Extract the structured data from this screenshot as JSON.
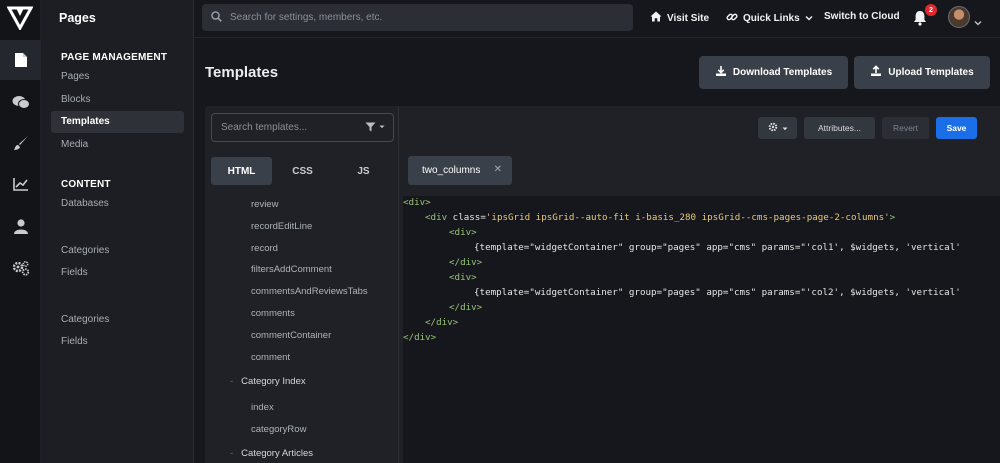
{
  "app": {
    "title": "Pages"
  },
  "sidebar": {
    "sections": [
      {
        "title": "PAGE MANAGEMENT",
        "items": [
          "Pages",
          "Blocks",
          "Templates",
          "Media"
        ]
      },
      {
        "title": "CONTENT",
        "items": [
          "Databases"
        ]
      }
    ],
    "extra_groups": [
      [
        "Categories",
        "Fields"
      ],
      [
        "Categories",
        "Fields"
      ]
    ],
    "active_item": "Templates"
  },
  "topbar": {
    "search_placeholder": "Search for settings, members, etc.",
    "visit_site": "Visit Site",
    "quick_links": "Quick Links",
    "switch_cloud": "Switch to Cloud",
    "notification_count": "2"
  },
  "page": {
    "title": "Templates",
    "download_button": "Download Templates",
    "upload_button": "Upload Templates"
  },
  "editor": {
    "search_placeholder": "Search templates...",
    "lang_tabs": [
      "HTML",
      "CSS",
      "JS"
    ],
    "active_lang": "HTML",
    "tree": {
      "items_a": [
        "review",
        "recordEditLine",
        "record",
        "filtersAddComment",
        "commentsAndReviewsTabs",
        "comments",
        "commentContainer",
        "comment"
      ],
      "group_1": "Category Index",
      "items_b": [
        "index",
        "categoryRow"
      ],
      "group_2": "Category Articles"
    },
    "toolbar": {
      "attributes": "Attributes...",
      "revert": "Revert",
      "save": "Save"
    },
    "open_file": "two_columns",
    "code": {
      "l1_open": "<div>",
      "l2_tag": "<div ",
      "l2_attr": "class=",
      "l2_val": "'ipsGrid ipsGrid--auto-fit i-basis_280 ipsGrid--cms-pages-page-2-columns'",
      "l2_end": ">",
      "l3": "<div>",
      "l4_a": "{template=\"widgetContainer\" group=\"pages\" app=\"cms\" params=\"'col1', $widgets, 'vertical'",
      "l5": "</div>",
      "l6": "<div>",
      "l7_a": "{template=\"widgetContainer\" group=\"pages\" app=\"cms\" params=\"'col2', $widgets, 'vertical'",
      "l8": "</div>",
      "l9": "</div>",
      "l10": "</div>"
    }
  },
  "colors": {
    "accent": "#1a6fe8",
    "badge": "#e0282e",
    "code_tag": "#98c379",
    "code_string": "#e8c97a"
  }
}
